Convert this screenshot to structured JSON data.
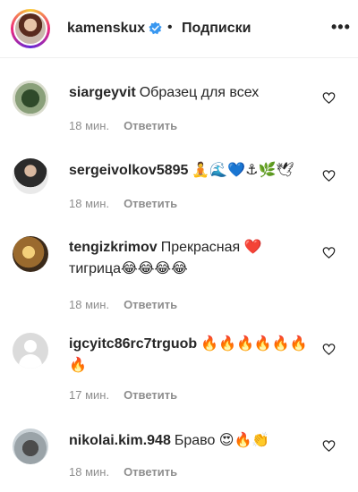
{
  "header": {
    "username": "kamenskux",
    "separator": "•",
    "follow_label": "Подписки",
    "more_label": "•••"
  },
  "comments": [
    {
      "username": "siargeyvit",
      "text": "Образец для всех",
      "time": "18 мин.",
      "reply": "Ответить"
    },
    {
      "username": "sergeivolkov5895",
      "text": "🧘🌊💙⚓🌿🕊",
      "time": "18 мин.",
      "reply": "Ответить"
    },
    {
      "username": "tengizkrimov",
      "text": "Прекрасная ❤️ тигрица😂😂😂😂",
      "time": "18 мин.",
      "reply": "Ответить"
    },
    {
      "username": "igcyitc86rc7trguob",
      "text": "🔥🔥🔥🔥🔥🔥🔥",
      "time": "17 мин.",
      "reply": "Ответить"
    },
    {
      "username": "nikolai.kim.948",
      "text": "Браво 😍🔥👏",
      "time": "18 мин.",
      "reply": "Ответить"
    }
  ],
  "colors": {
    "text": "#262626",
    "meta": "#8e8e8e",
    "verified": "#3897f0"
  }
}
